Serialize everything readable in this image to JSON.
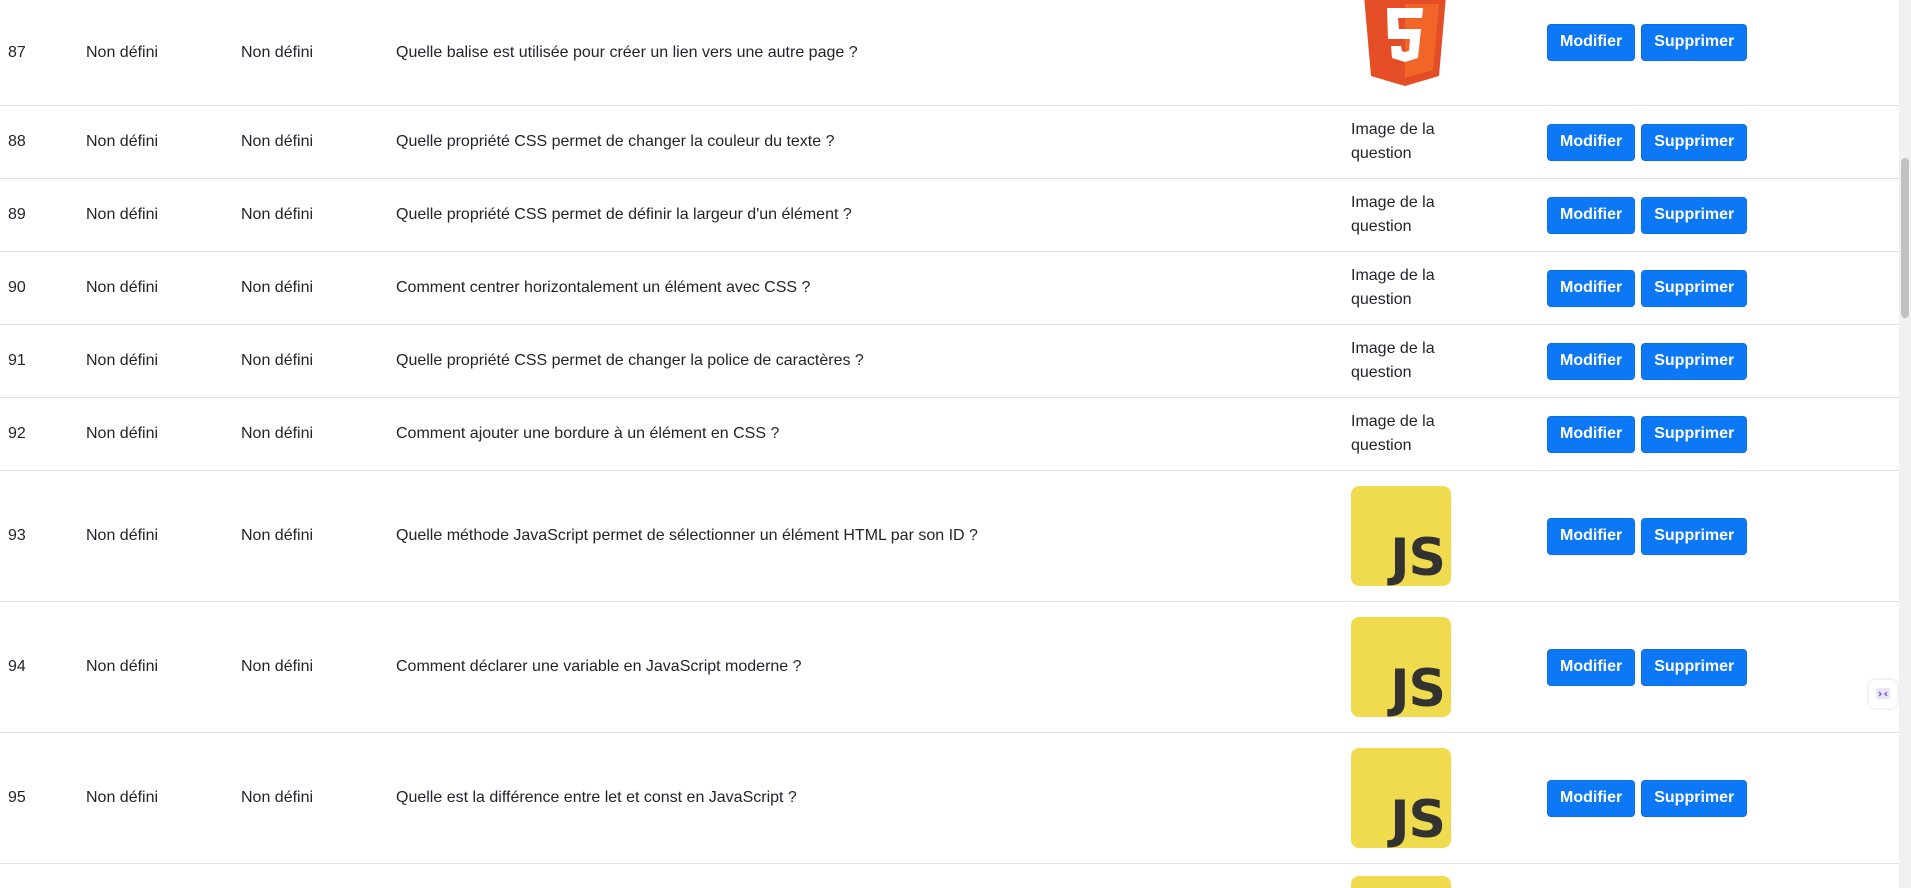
{
  "rows": [
    {
      "id": "87",
      "category": "Non défini",
      "difficulty": "Non défini",
      "question": "Quelle balise est utilisée pour créer un lien vers une autre page ?",
      "image": {
        "type": "html5-logo",
        "label": "5"
      }
    },
    {
      "id": "88",
      "category": "Non défini",
      "difficulty": "Non défini",
      "question": "Quelle propriété CSS permet de changer la couleur du texte ?",
      "image": {
        "type": "broken",
        "alt": "Image de la question"
      }
    },
    {
      "id": "89",
      "category": "Non défini",
      "difficulty": "Non défini",
      "question": "Quelle propriété CSS permet de définir la largeur d'un élément ?",
      "image": {
        "type": "broken",
        "alt": "Image de la question"
      }
    },
    {
      "id": "90",
      "category": "Non défini",
      "difficulty": "Non défini",
      "question": "Comment centrer horizontalement un élément avec CSS ?",
      "image": {
        "type": "broken",
        "alt": "Image de la question"
      }
    },
    {
      "id": "91",
      "category": "Non défini",
      "difficulty": "Non défini",
      "question": "Quelle propriété CSS permet de changer la police de caractères ?",
      "image": {
        "type": "broken",
        "alt": "Image de la question"
      }
    },
    {
      "id": "92",
      "category": "Non défini",
      "difficulty": "Non défini",
      "question": "Comment ajouter une bordure à un élément en CSS ?",
      "image": {
        "type": "broken",
        "alt": "Image de la question"
      }
    },
    {
      "id": "93",
      "category": "Non défini",
      "difficulty": "Non défini",
      "question": "Quelle méthode JavaScript permet de sélectionner un élément HTML par son ID ?",
      "image": {
        "type": "js-logo",
        "label": "JS"
      }
    },
    {
      "id": "94",
      "category": "Non défini",
      "difficulty": "Non défini",
      "question": "Comment déclarer une variable en JavaScript moderne ?",
      "image": {
        "type": "js-logo",
        "label": "JS"
      }
    },
    {
      "id": "95",
      "category": "Non défini",
      "difficulty": "Non défini",
      "question": "Quelle est la différence entre let et const en JavaScript ?",
      "image": {
        "type": "js-logo",
        "label": "JS"
      }
    }
  ],
  "actions": {
    "edit_label": "Modifier",
    "delete_label": "Supprimer"
  },
  "colors": {
    "button": "#0d78f5",
    "js_yellow": "#f0db4f",
    "html5_orange": "#e44d26"
  }
}
